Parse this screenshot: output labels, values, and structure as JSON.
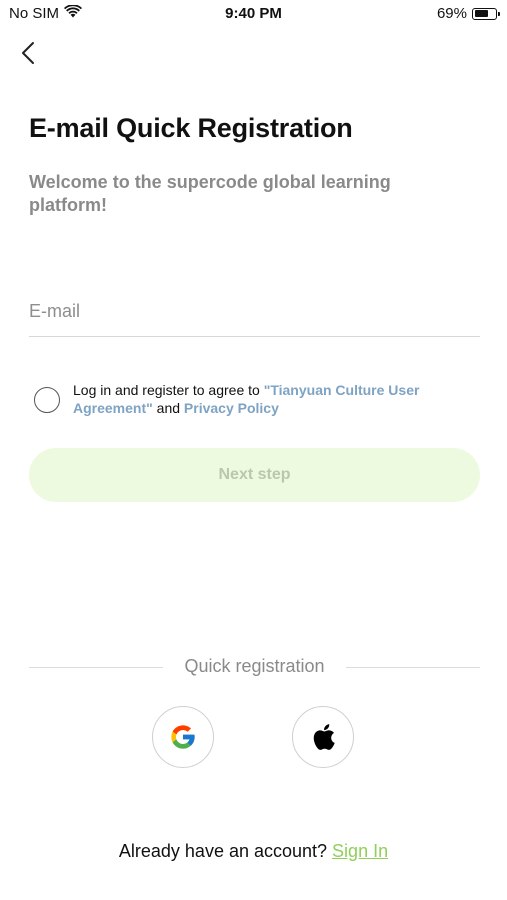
{
  "status_bar": {
    "carrier": "No SIM",
    "time": "9:40 PM",
    "battery_percent": "69%",
    "battery_level": 0.69
  },
  "icons": {
    "back": "chevron-left-icon",
    "wifi": "wifi-icon",
    "battery": "battery-icon",
    "google": "google-icon",
    "apple": "apple-icon"
  },
  "header": {
    "title": "E-mail Quick Registration",
    "subtitle": "Welcome to the supercode global learning platform!"
  },
  "form": {
    "email_value": "",
    "email_placeholder": "E-mail",
    "agree_prefix": "Log in and register to agree to ",
    "agree_link_terms": "\"Tianyuan Culture User Agreement\"",
    "agree_and": " and ",
    "agree_link_privacy": "Privacy Policy",
    "agree_checked": false,
    "next_label": "Next step"
  },
  "quick_registration": {
    "label": "Quick registration"
  },
  "footer": {
    "question": "Already have an account? ",
    "signin_label": "Sign In"
  },
  "colors": {
    "accent_green": "#8fcf5a",
    "button_bg_disabled": "#eefadf",
    "link_blue": "#7ea3c3"
  }
}
